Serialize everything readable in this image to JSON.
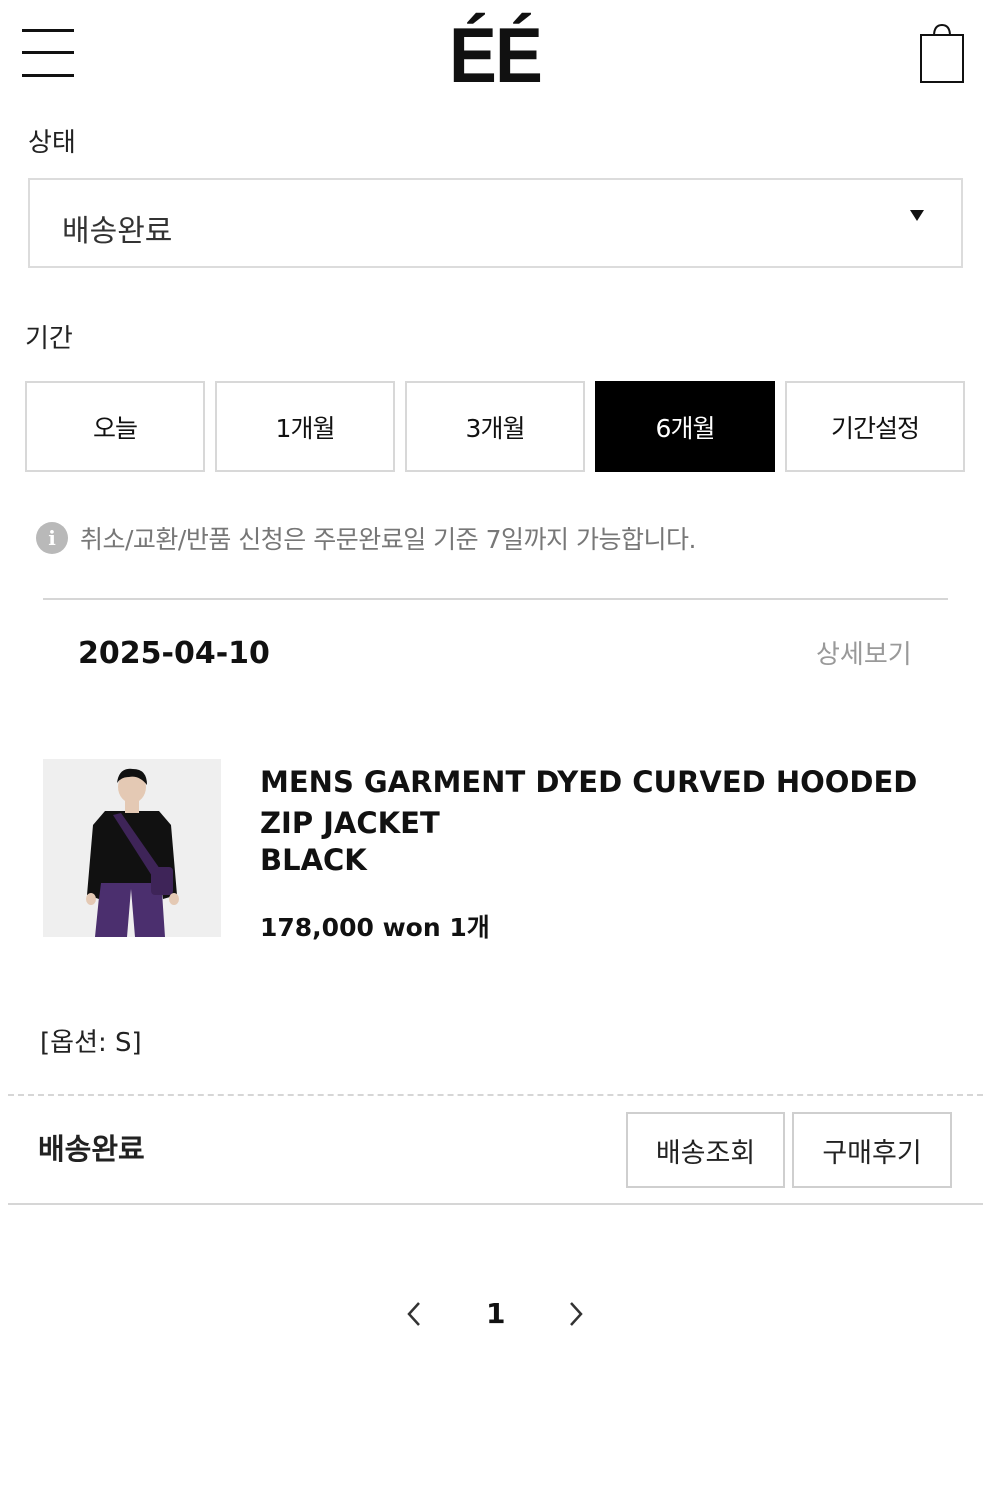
{
  "header": {
    "logo": "ÉÉ",
    "menu_icon": "hamburger-menu-icon",
    "cart_icon": "shopping-bag-icon"
  },
  "status_filter": {
    "label": "상태",
    "selected": "배송완료"
  },
  "period_filter": {
    "label": "기간",
    "options": [
      "오늘",
      "1개월",
      "3개월",
      "6개월",
      "기간설정"
    ],
    "active": "6개월"
  },
  "notice": {
    "icon": "info-icon",
    "text": "취소/교환/반품 신청은 주문완료일 기준 7일까지 가능합니다."
  },
  "order": {
    "date": "2025-04-10",
    "detail_link": "상세보기",
    "product": {
      "name": "MENS GARMENT DYED CURVED HOODED ZIP JACKET",
      "color": "BLACK",
      "price": "178,000 won",
      "quantity": "1개"
    },
    "option": "[옵션: S]",
    "status": "배송완료",
    "actions": [
      "배송조회",
      "구매후기"
    ]
  },
  "pagination": {
    "current": "1",
    "prev_icon": "chevron-left-icon",
    "next_icon": "chevron-right-icon"
  },
  "colors": {
    "active_button": "#000000",
    "border": "#d8d8d8",
    "muted_text": "#999999",
    "info_icon": "#b9b9b9"
  }
}
